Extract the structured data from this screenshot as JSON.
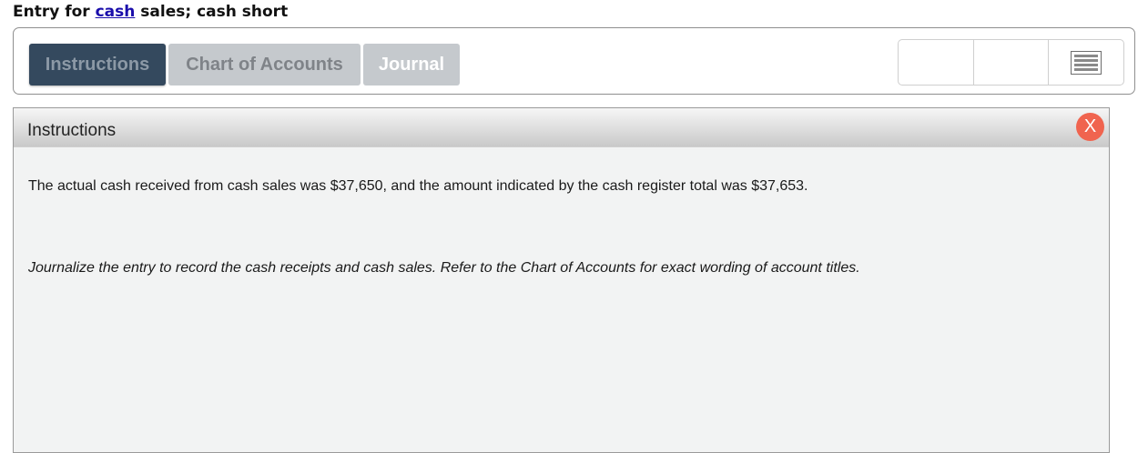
{
  "heading": {
    "prefix": "Entry for ",
    "link": "cash",
    "suffix": " sales; cash short"
  },
  "tabs": {
    "instructions": "Instructions",
    "chart_of_accounts": "Chart of Accounts",
    "journal": "Journal"
  },
  "tools": {
    "menu_icon": "hamburger-menu-icon"
  },
  "panel": {
    "title": "Instructions",
    "close_label": "X",
    "body_text": "The actual cash received from cash sales was $37,650, and the amount indicated by the cash register total was $37,653.",
    "directive_text": "Journalize the entry to record the cash receipts and cash sales. Refer to the Chart of Accounts for exact wording of account titles."
  },
  "colors": {
    "active_tab": "#34495e",
    "inactive_tab": "#c5c9cd",
    "close_button": "#f0644f",
    "link": "#1a0dab"
  }
}
